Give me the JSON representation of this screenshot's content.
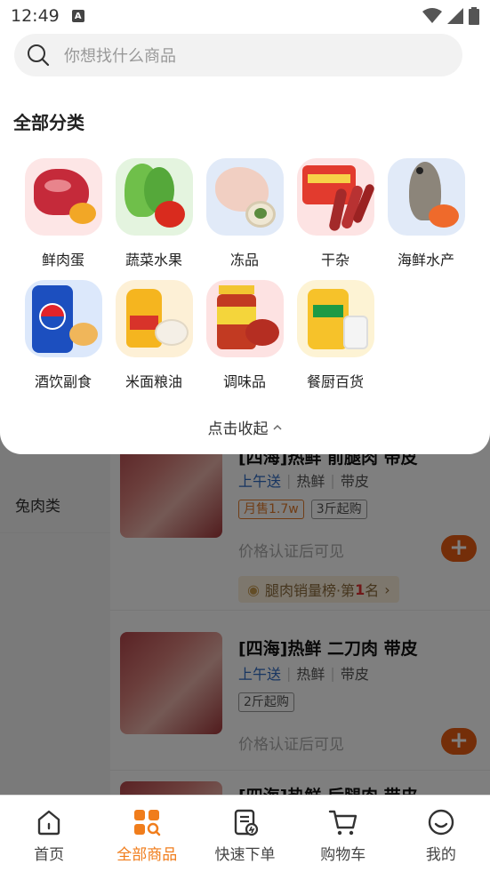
{
  "status_bar": {
    "time": "12:49"
  },
  "search": {
    "placeholder": "你想找什么商品"
  },
  "category_panel": {
    "title": "全部分类",
    "categories": [
      {
        "name": "鲜肉蛋",
        "icon": "meat-egg-image"
      },
      {
        "name": "蔬菜水果",
        "icon": "vegetable-fruit-image"
      },
      {
        "name": "冻品",
        "icon": "frozen-food-image"
      },
      {
        "name": "干杂",
        "icon": "dried-goods-image"
      },
      {
        "name": "海鲜水产",
        "icon": "seafood-image"
      },
      {
        "name": "酒饮副食",
        "icon": "drinks-snacks-image"
      },
      {
        "name": "米面粮油",
        "icon": "rice-oil-image"
      },
      {
        "name": "调味品",
        "icon": "seasoning-image"
      },
      {
        "name": "餐厨百货",
        "icon": "kitchen-goods-image"
      }
    ],
    "collapse_label": "点击收起"
  },
  "sidebar": {
    "items": [
      {
        "label": "兔肉类"
      }
    ]
  },
  "products": [
    {
      "title": "[四海]热鲜 前腿肉 带皮",
      "delivery": "上午送",
      "tag1": "热鲜",
      "tag2": "带皮",
      "pills": [
        "月售1.7w",
        "3斤起购"
      ],
      "price": "价格认证后可见",
      "rank_prefix": "腿肉销量榜·第",
      "rank_num": "1",
      "rank_suffix": "名"
    },
    {
      "title": "[四海]热鲜 二刀肉 带皮",
      "delivery": "上午送",
      "tag1": "热鲜",
      "tag2": "带皮",
      "pills": [
        "2斤起购"
      ],
      "price": "价格认证后可见"
    },
    {
      "title": "[四海]热鲜 后腿肉 带皮"
    }
  ],
  "tabbar": {
    "items": [
      {
        "label": "首页",
        "icon": "home-icon"
      },
      {
        "label": "全部商品",
        "icon": "all-products-icon"
      },
      {
        "label": "快速下单",
        "icon": "quick-order-icon"
      },
      {
        "label": "购物车",
        "icon": "cart-icon"
      },
      {
        "label": "我的",
        "icon": "profile-icon"
      }
    ],
    "active": "全部商品"
  },
  "colors": {
    "accent": "#f07d1c",
    "add_button": "#e85c12",
    "delivery_blue": "#2f6ac2"
  }
}
